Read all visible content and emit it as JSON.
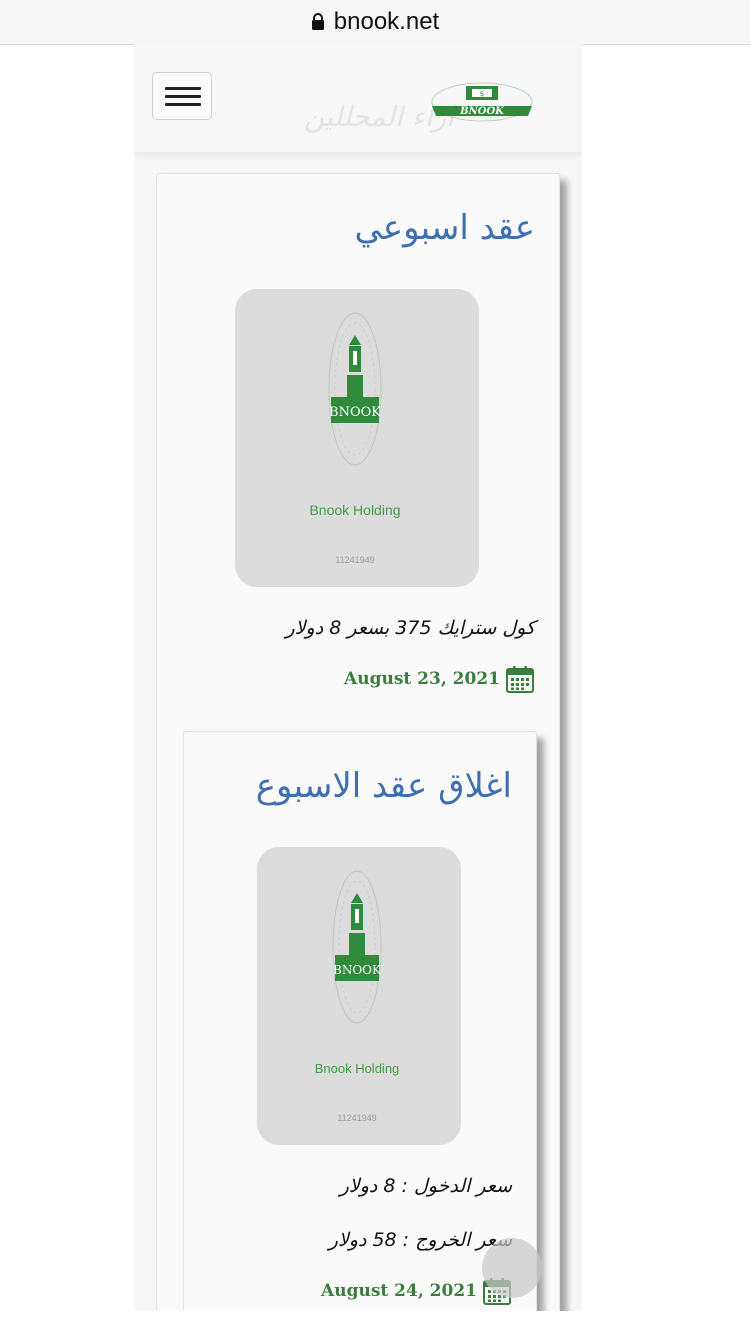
{
  "browser": {
    "url": "bnook.net"
  },
  "header": {
    "title": "اراء المحللين",
    "logo_text": "BNOOK"
  },
  "posts": [
    {
      "title": "عقد اسبوعي",
      "thumb_brand": "BNOOK",
      "thumb_caption": "Bnook Holding",
      "thumb_code": "11241949",
      "lines": [
        "كول سترايك 375 بسعر 8 دولار"
      ],
      "date": "August 23, 2021"
    },
    {
      "title": "اغلاق عقد الاسبوع",
      "thumb_brand": "BNOOK",
      "thumb_caption": "Bnook Holding",
      "thumb_code": "11241949",
      "lines": [
        "سعر الدخول : 8 دولار",
        "سعر الخروج : 58 دولار"
      ],
      "date": "August 24, 2021"
    }
  ],
  "colors": {
    "title": "#3e6fb0",
    "date": "#3b7d3c",
    "brand_green": "#2f8a3c"
  }
}
